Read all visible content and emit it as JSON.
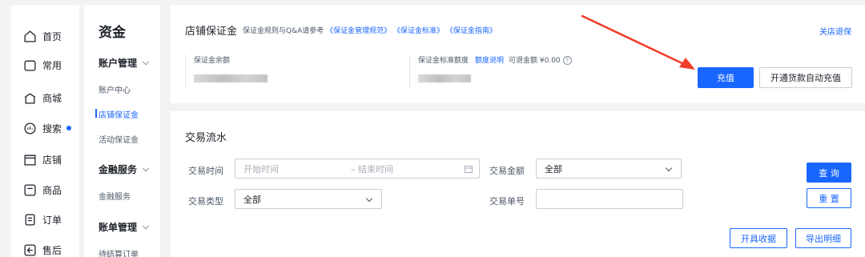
{
  "nav": {
    "items": [
      {
        "label": "首页",
        "icon": "home-icon"
      },
      {
        "label": "常用",
        "icon": "folder-icon"
      },
      {
        "label": "商城",
        "icon": "mall-icon"
      },
      {
        "label": "搜索",
        "icon": "search-icon"
      },
      {
        "label": "店铺",
        "icon": "shop-icon"
      },
      {
        "label": "商品",
        "icon": "product-icon"
      },
      {
        "label": "订单",
        "icon": "order-icon"
      },
      {
        "label": "售后",
        "icon": "after-sale-icon"
      }
    ]
  },
  "subnav": {
    "title": "资金",
    "groups": [
      {
        "label": "账户管理",
        "items": [
          "账户中心",
          "店铺保证金",
          "活动保证金"
        ]
      },
      {
        "label": "金融服务",
        "items": [
          "金融服务"
        ]
      },
      {
        "label": "账单管理",
        "items": [
          "待结算订单"
        ]
      }
    ],
    "active_item": "店铺保证金"
  },
  "deposit": {
    "title": "店铺保证金",
    "rules_prefix": "保证金规则与Q&A请参考",
    "rules_links": [
      "《保证金管理规范》",
      "《保证金标准》",
      "《保证金指南》"
    ],
    "close_link": "关店退保",
    "balance_label": "保证金余额",
    "standard_label": "保证金标准额度",
    "quota_link": "额度说明",
    "refundable": "可退金额 ¥0.00",
    "help_glyph": "?",
    "recharge_button": "充值",
    "auto_recharge_button": "开通货款自动充值"
  },
  "flow": {
    "title": "交易流水",
    "time_label": "交易时间",
    "start_placeholder": "开始时间",
    "end_placeholder": "– 结束时间",
    "amount_label": "交易金额",
    "amount_value": "全部",
    "type_label": "交易类型",
    "type_value": "全部",
    "order_label": "交易单号",
    "order_value": "",
    "query_button": "查 询",
    "reset_button": "重 置",
    "receipt_button": "开具收据",
    "export_button": "导出明细"
  },
  "colors": {
    "accent": "#1966ff",
    "arrow": "#f03c2a"
  }
}
